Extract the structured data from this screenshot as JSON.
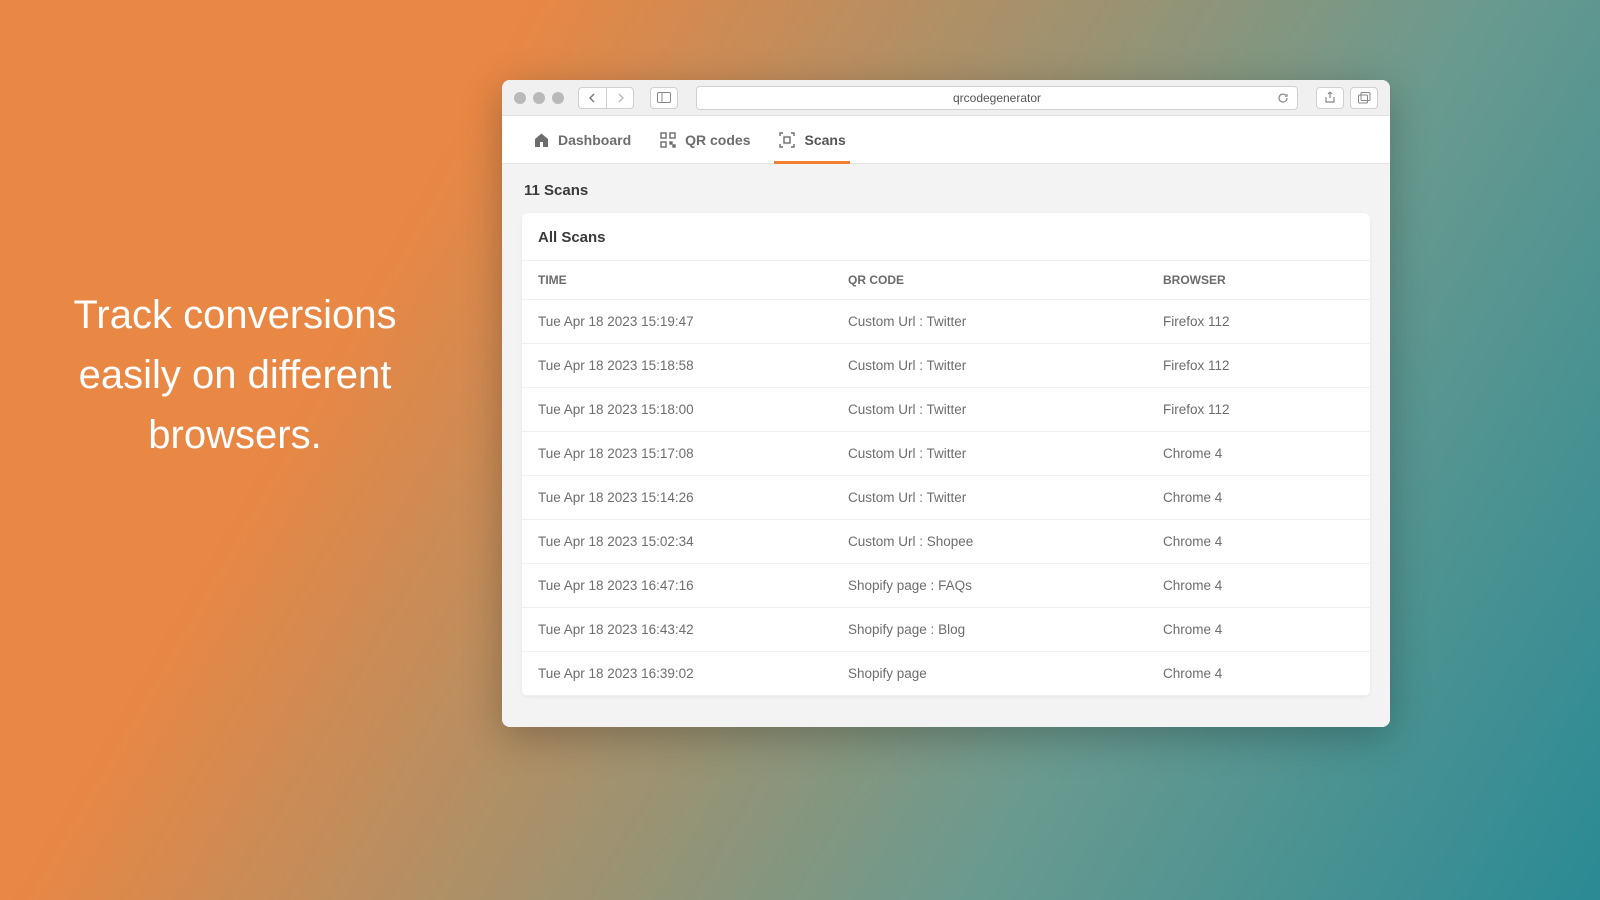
{
  "hero": {
    "text": "Track conversions easily on different browsers."
  },
  "browser": {
    "url": "qrcodegenerator"
  },
  "tabs": {
    "dashboard": "Dashboard",
    "qrcodes": "QR codes",
    "scans": "Scans"
  },
  "page": {
    "count_label": "11 Scans",
    "card_title": "All Scans",
    "columns": {
      "time": "TIME",
      "qrcode": "QR CODE",
      "browser": "BROWSER"
    },
    "rows": [
      {
        "time": "Tue Apr 18 2023 15:19:47",
        "qrcode": "Custom Url : Twitter",
        "browser": "Firefox 112"
      },
      {
        "time": "Tue Apr 18 2023 15:18:58",
        "qrcode": "Custom Url : Twitter",
        "browser": "Firefox 112"
      },
      {
        "time": "Tue Apr 18 2023 15:18:00",
        "qrcode": "Custom Url : Twitter",
        "browser": "Firefox 112"
      },
      {
        "time": "Tue Apr 18 2023 15:17:08",
        "qrcode": "Custom Url : Twitter",
        "browser": "Chrome 4"
      },
      {
        "time": "Tue Apr 18 2023 15:14:26",
        "qrcode": "Custom Url : Twitter",
        "browser": "Chrome 4"
      },
      {
        "time": "Tue Apr 18 2023 15:02:34",
        "qrcode": "Custom Url : Shopee",
        "browser": "Chrome 4"
      },
      {
        "time": "Tue Apr 18 2023 16:47:16",
        "qrcode": "Shopify page : FAQs",
        "browser": "Chrome 4"
      },
      {
        "time": "Tue Apr 18 2023 16:43:42",
        "qrcode": "Shopify page : Blog",
        "browser": "Chrome 4"
      },
      {
        "time": "Tue Apr 18 2023 16:39:02",
        "qrcode": "Shopify page",
        "browser": "Chrome 4"
      }
    ]
  }
}
